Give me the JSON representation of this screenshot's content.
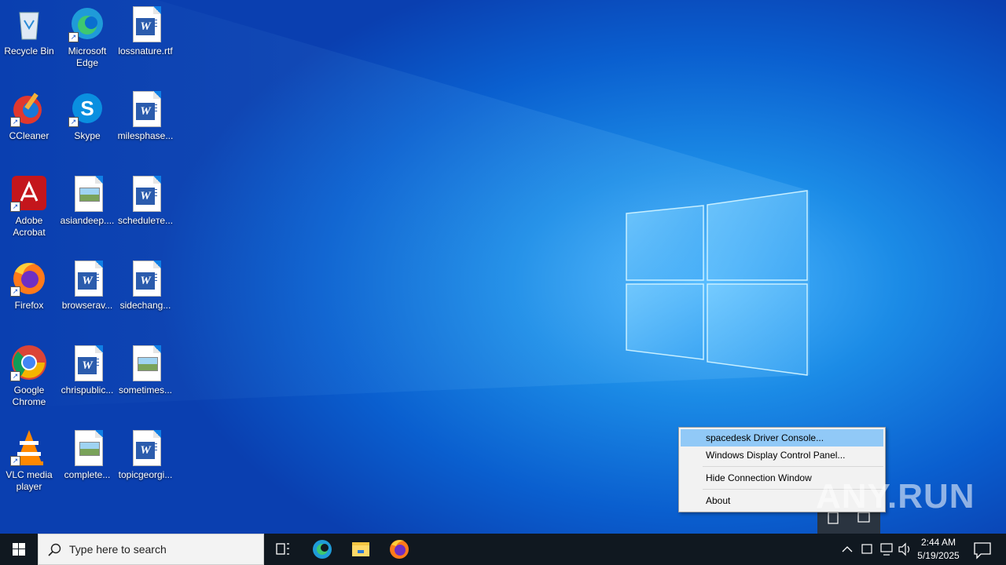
{
  "desktop": {
    "icons": [
      {
        "label": "Recycle Bin",
        "kind": "recycle-bin"
      },
      {
        "label": "Microsoft Edge",
        "kind": "edge"
      },
      {
        "label": "lossnature.rtf",
        "kind": "word"
      },
      {
        "label": "CCleaner",
        "kind": "ccleaner"
      },
      {
        "label": "Skype",
        "kind": "skype"
      },
      {
        "label": "milesphase...",
        "kind": "word"
      },
      {
        "label": "Adobe Acrobat",
        "kind": "acrobat"
      },
      {
        "label": "asiandeep....",
        "kind": "image"
      },
      {
        "label": "scheduleте...",
        "kind": "word"
      },
      {
        "label": "Firefox",
        "kind": "firefox"
      },
      {
        "label": "browserav...",
        "kind": "word"
      },
      {
        "label": "sidechang...",
        "kind": "word"
      },
      {
        "label": "Google Chrome",
        "kind": "chrome"
      },
      {
        "label": "chrispublic...",
        "kind": "word"
      },
      {
        "label": "sometimes...",
        "kind": "image"
      },
      {
        "label": "VLC media player",
        "kind": "vlc"
      },
      {
        "label": "complete...",
        "kind": "image"
      },
      {
        "label": "topicgeorgi...",
        "kind": "word"
      }
    ]
  },
  "context_menu": {
    "items": [
      {
        "label": "spacedesk Driver Console...",
        "highlighted": true
      },
      {
        "label": "Windows Display Control Panel..."
      },
      {
        "label": "Hide Connection Window"
      },
      {
        "label": "About"
      }
    ]
  },
  "taskbar": {
    "search_placeholder": "Type here to search",
    "pinned": [
      "task-view-icon",
      "edge-icon",
      "file-explorer-icon",
      "firefox-icon"
    ],
    "tray_icons": [
      "show-hidden-icons-chevron",
      "spacedesk-tray-icon",
      "network-icon",
      "volume-icon"
    ],
    "time": "2:44 AM",
    "date": "5/19/2025"
  },
  "watermark": "ANY.RUN"
}
